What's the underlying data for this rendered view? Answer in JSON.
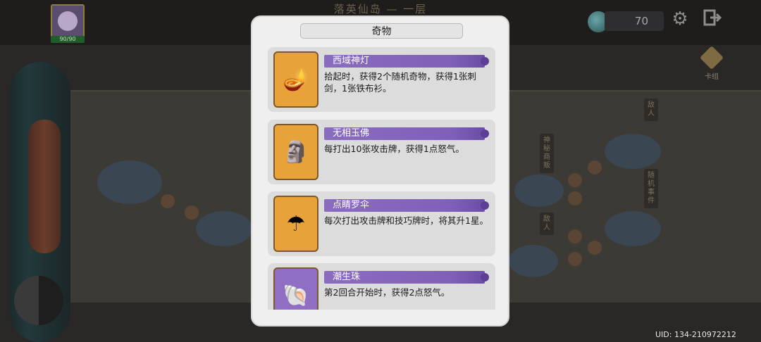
{
  "background": {
    "title_hint": "落英仙岛 — 一层",
    "side_tags": [
      "敌人",
      "神秘商贩",
      "随机事件",
      "敌人"
    ]
  },
  "hud": {
    "hp": "90/90",
    "coins": "70",
    "deck_label": "卡组",
    "uid": "UID: 134-210972212",
    "icons": {
      "settings": "gear-icon",
      "exit": "exit-icon",
      "coin": "pearl-coin-icon",
      "deck": "deck-icon"
    }
  },
  "modal": {
    "title": "奇物",
    "items": [
      {
        "name": "西域神灯",
        "desc": "拾起时，获得2个随机奇物，获得1张刺剑，1张铁布衫。",
        "icon": "magic-lamp-icon",
        "icon_bg": "#e8a23a",
        "glyph": "🪔"
      },
      {
        "name": "无相玉佛",
        "desc": "每打出10张攻击牌，获得1点怒气。",
        "icon": "jade-buddha-icon",
        "icon_bg": "#e8a23a",
        "glyph": "🗿"
      },
      {
        "name": "点睛罗伞",
        "desc": "每次打出攻击牌和技巧牌时，将其升1星。",
        "icon": "umbrella-icon",
        "icon_bg": "#e8a23a",
        "glyph": "☂"
      },
      {
        "name": "潮生珠",
        "desc": "第2回合开始时，获得2点怒气。",
        "icon": "pearl-shell-icon",
        "icon_bg": "#8f6fc4",
        "glyph": "🐚"
      }
    ]
  }
}
